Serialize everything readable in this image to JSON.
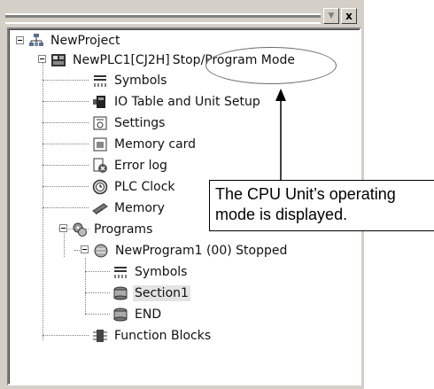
{
  "window": {
    "dropdown_glyph": "▼",
    "close_glyph": "x"
  },
  "tree": {
    "project": {
      "label": "NewProject",
      "icon": "network-icon"
    },
    "plc": {
      "label": "NewPLC1[CJ2H]",
      "mode": "Stop/Program Mode",
      "icon": "plc-icon"
    },
    "plc_children": [
      {
        "label": "Symbols",
        "icon": "symbols-icon"
      },
      {
        "label": "IO Table and Unit Setup",
        "icon": "io-table-icon"
      },
      {
        "label": "Settings",
        "icon": "settings-icon"
      },
      {
        "label": "Memory card",
        "icon": "memory-card-icon"
      },
      {
        "label": "Error log",
        "icon": "error-log-icon"
      },
      {
        "label": "PLC Clock",
        "icon": "clock-icon"
      },
      {
        "label": "Memory",
        "icon": "memory-icon"
      },
      {
        "label": "Programs",
        "icon": "programs-icon"
      }
    ],
    "program": {
      "label": "NewProgram1 (00) Stopped",
      "icon": "program-icon"
    },
    "program_children": [
      {
        "label": "Symbols",
        "icon": "symbols-icon"
      },
      {
        "label": "Section1",
        "icon": "section-icon",
        "selected": true
      },
      {
        "label": "END",
        "icon": "section-icon"
      }
    ],
    "function_blocks": {
      "label": "Function Blocks",
      "icon": "function-blocks-icon"
    }
  },
  "callout": {
    "line1": "The CPU Unit’s operating",
    "line2": "mode is displayed."
  }
}
